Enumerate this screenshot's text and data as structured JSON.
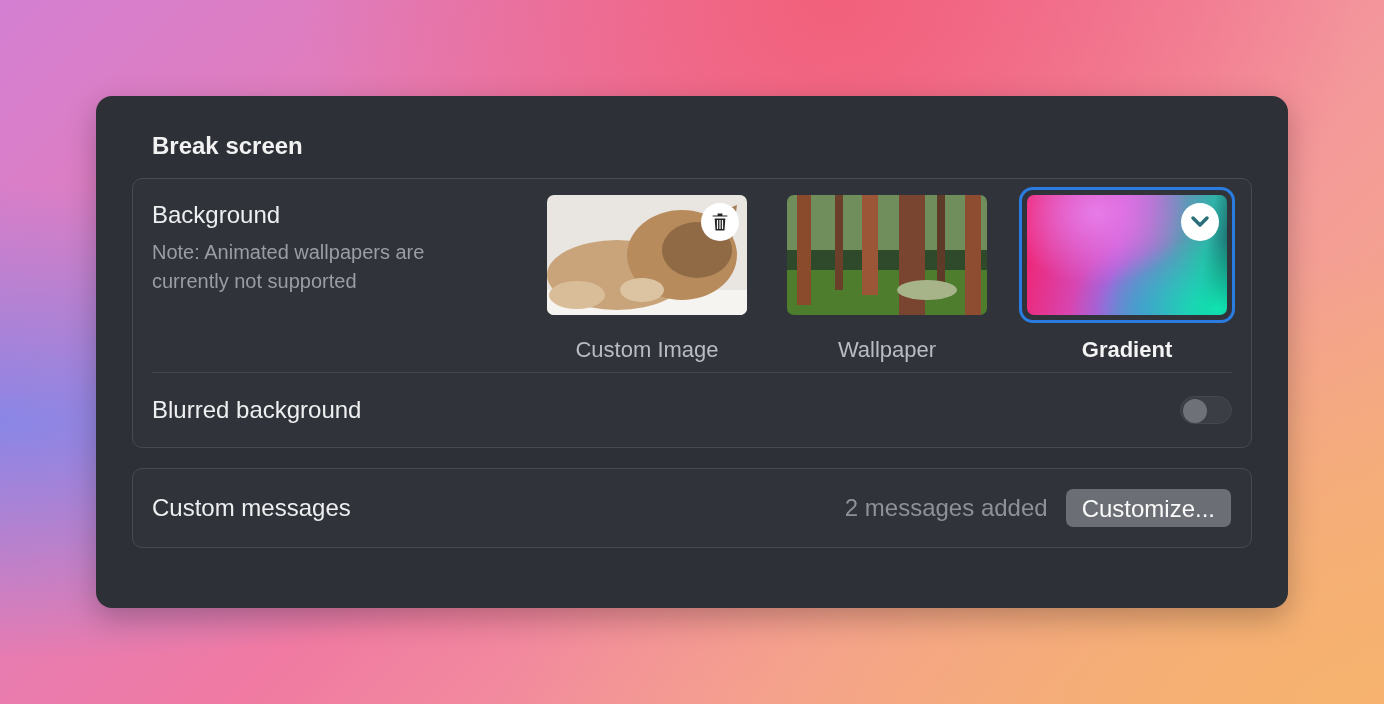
{
  "window": {
    "title": "Break screen"
  },
  "background": {
    "label": "Background",
    "note": "Note: Animated wallpapers are currently not supported",
    "options": [
      {
        "label": "Custom Image",
        "selected": false,
        "deletable": true
      },
      {
        "label": "Wallpaper",
        "kind": "forest",
        "selected": false,
        "deletable": false
      },
      {
        "label": "Gradient",
        "kind": "gradient",
        "selected": true,
        "deletable": false
      }
    ]
  },
  "blurred_background": {
    "label": "Blurred background",
    "on": false
  },
  "custom_messages": {
    "label": "Custom messages",
    "count": "2 messages added",
    "button": "Customize..."
  }
}
